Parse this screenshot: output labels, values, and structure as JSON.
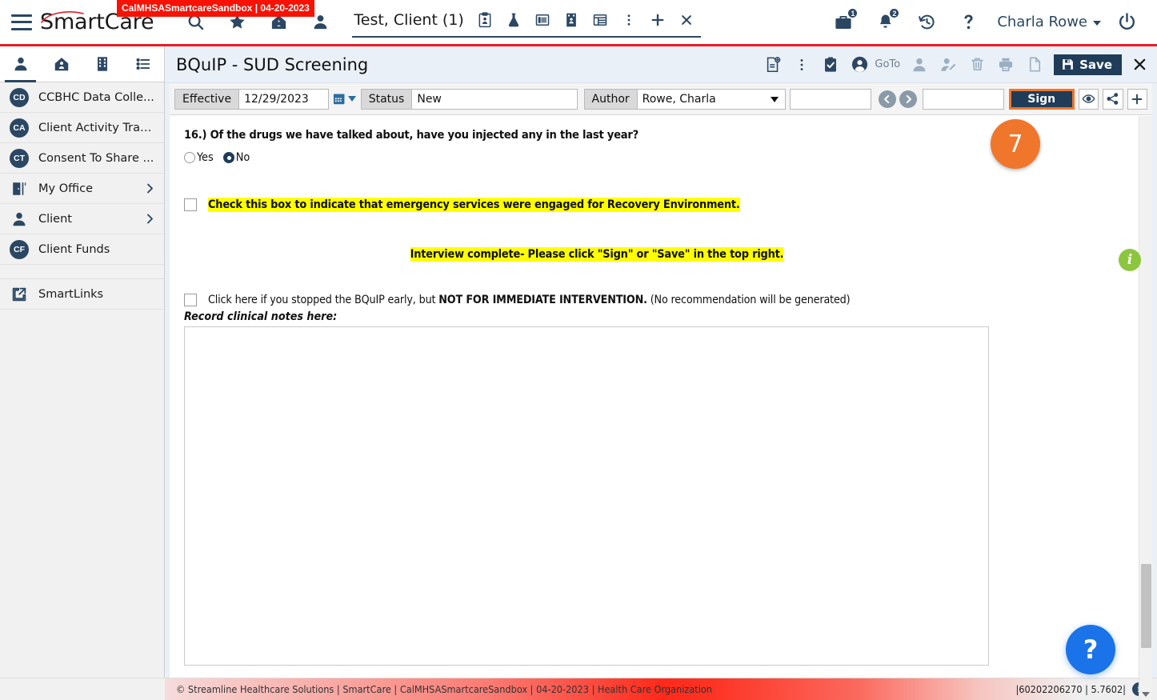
{
  "header": {
    "logo_text": "SmartCare",
    "env_badge": "CalMHSASmartcareSandbox | 04-20-2023",
    "menu_icon": "hamburger-icon",
    "icons": [
      "search-icon",
      "star-icon",
      "home-icon",
      "person-icon"
    ],
    "client_tab": {
      "name": "Test, Client (1)",
      "icons": [
        "clipboard-person-icon",
        "flask-icon",
        "list-document-icon",
        "building-person-icon",
        "table-icon",
        "kebab-menu-icon",
        "plus-icon",
        "close-icon"
      ]
    },
    "right": {
      "briefcase_count": "1",
      "bell_count": "2",
      "history_icon": "history-icon",
      "help_icon": "question-mark-icon",
      "user_name": "Charla Rowe",
      "power_icon": "power-icon"
    }
  },
  "sidebar": {
    "tabs": [
      {
        "name": "tab-client",
        "icon": "person-icon",
        "active": true
      },
      {
        "name": "tab-home",
        "icon": "home-icon",
        "active": false
      },
      {
        "name": "tab-organization",
        "icon": "building-icon",
        "active": false
      },
      {
        "name": "tab-list",
        "icon": "list-icon",
        "active": false
      }
    ],
    "items": [
      {
        "badge": "CD",
        "label": "CCBHC Data Colle...",
        "chevron": false
      },
      {
        "badge": "CA",
        "label": "Client Activity Trac...",
        "chevron": false
      },
      {
        "badge": "CT",
        "label": "Consent To Share ...",
        "chevron": false
      },
      {
        "badge": "",
        "icon": "office-door-icon",
        "label": "My Office",
        "chevron": true
      },
      {
        "badge": "",
        "icon": "person-icon",
        "label": "Client",
        "chevron": true
      },
      {
        "badge": "CF",
        "label": "Client Funds",
        "chevron": false
      }
    ],
    "smartlinks": {
      "label": "SmartLinks",
      "icon": "external-link-icon"
    }
  },
  "page": {
    "title": "BQuIP - SUD Screening",
    "toolbar": [
      {
        "name": "new-document-icon",
        "disabled": false
      },
      {
        "name": "kebab-menu-icon",
        "disabled": false
      },
      {
        "name": "clipboard-check-icon",
        "disabled": false
      },
      {
        "name": "account-circle-icon",
        "disabled": false
      },
      {
        "name": "person-icon",
        "disabled": true
      },
      {
        "name": "person-edit-icon",
        "disabled": true
      },
      {
        "name": "trash-icon",
        "disabled": true
      },
      {
        "name": "printer-icon",
        "disabled": true
      },
      {
        "name": "page-icon",
        "disabled": true
      }
    ],
    "goto_label": "GoTo",
    "save_label": "Save",
    "close_label": "✕"
  },
  "meta": {
    "effective_label": "Effective",
    "effective_value": "12/29/2023",
    "calendar_icon": "calendar-icon",
    "status_label": "Status",
    "status_value": "New",
    "author_label": "Author",
    "author_value": "Rowe, Charla",
    "blank_field_1": "",
    "blank_field_2": "",
    "prev_icon": "arrow-left-icon",
    "next_icon": "arrow-right-icon",
    "sign_label": "Sign",
    "eye_icon": "eye-icon",
    "share_icon": "share-icon",
    "plus_icon": "plus-icon"
  },
  "annotations": {
    "step_number": "7",
    "info_badge": "i",
    "help_fab": "?"
  },
  "form": {
    "question_16": "16.) Of the drugs we have talked about, have you injected any in the last year?",
    "radio_yes": "Yes",
    "radio_no": "No",
    "radio_selected": "No",
    "emergency_checkbox_label": "Check this box to indicate that emergency services were engaged for Recovery Environment.",
    "interview_complete": "Interview complete- Please click \"Sign\" or \"Save\" in the top right.",
    "stopped_early_prefix": "Click here if you stopped the BQuIP early, but ",
    "stopped_early_bold": "NOT FOR IMMEDIATE INTERVENTION.",
    "stopped_early_suffix": " (No recommendation will be generated)",
    "notes_label": "Record clinical notes here:",
    "notes_value": ""
  },
  "footer": {
    "left": "© Streamline Healthcare Solutions | SmartCare | CalMHSASmartcareSandbox | 04-20-2023 | Health Care Organization",
    "right": "|60202206270 | 5.7602|",
    "info_icon": "info-icon"
  },
  "colors": {
    "brand_red": "#ec1c24",
    "navy": "#2b4763",
    "accent_orange": "#f0762b",
    "highlight_yellow": "#ffff00",
    "save_navy": "#1f3c59",
    "green_info": "#8cc63e",
    "help_blue": "#1a73e8"
  }
}
